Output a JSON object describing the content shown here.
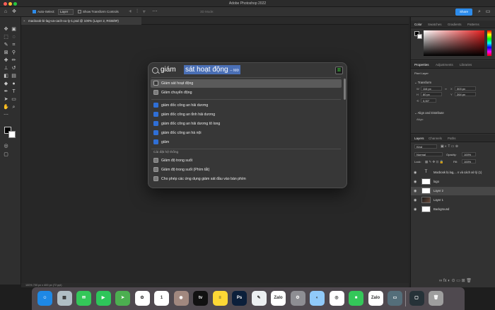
{
  "window": {
    "title": "Adobe Photoshop 2022"
  },
  "options_bar": {
    "auto_select_label": "Auto-Select:",
    "auto_select_value": "Layer",
    "show_transform_label": "Show Transform Controls",
    "mode_label": "3D Mode:",
    "share_label": "Share"
  },
  "document": {
    "tab_title": "macbook-bi-lag-va-cach-xu-ly-1.psd @ 100% (Layer 2, RGB/8#)",
    "status": "100%   700 px x 400 px (72 ppi)"
  },
  "spotlight": {
    "typed": "giám",
    "completion": "sát hoạt động",
    "completion_hint": "– Mở",
    "top_items": [
      {
        "label": "Giám sát hoạt động",
        "icon": "activity-monitor-icon",
        "selected": true
      },
      {
        "label": "Giảm chuyển động",
        "icon": "system-pref-icon",
        "selected": false
      }
    ],
    "doc_items": [
      {
        "label": "giám đốc công an hải dương",
        "icon": "document-icon"
      },
      {
        "label": "giám đốc công an tỉnh hải dương",
        "icon": "document-icon"
      },
      {
        "label": "giám đốc công an hải dương tô long",
        "icon": "document-icon"
      },
      {
        "label": "giám đốc công an hà nội",
        "icon": "document-icon"
      },
      {
        "label": "giảm",
        "icon": "document-icon"
      }
    ],
    "section_title": "Cài đặt hệ thống",
    "settings_items": [
      {
        "label": "Giảm độ trong suốt",
        "icon": "system-pref-icon"
      },
      {
        "label": "Giảm độ trong suốt (Phím tắt)",
        "icon": "system-pref-icon"
      },
      {
        "label": "Cho phép các ứng dụng giám sát đầu vào bàn phím",
        "icon": "system-pref-icon"
      }
    ]
  },
  "panels": {
    "color_tabs": [
      "Color",
      "Swatches",
      "Gradients",
      "Patterns"
    ],
    "properties_tabs": [
      "Properties",
      "Adjustments",
      "Libraries"
    ],
    "pixel_layer_label": "Pixel Layer",
    "transform_label": "Transform",
    "transform": {
      "w": "116 px",
      "h": "80 px",
      "x": "303 px",
      "y": "264 px",
      "angle": "0,00°"
    },
    "align_label": "Align and Distribute",
    "align_sub": "Align:",
    "layers_tabs": [
      "Layers",
      "Channels",
      "Paths"
    ],
    "kind_label": "Kind",
    "blend_mode": "Normal",
    "opacity_label": "Opacity:",
    "opacity_value": "100%",
    "lock_label": "Lock:",
    "fill_label": "Fill:",
    "fill_value": "100%",
    "layers": [
      {
        "name": "Macbook bị lag,... n và cách xử lý (1)",
        "thumb": "text",
        "selected": false
      },
      {
        "name": "logo",
        "thumb": "white",
        "selected": false
      },
      {
        "name": "Layer 2",
        "thumb": "white",
        "selected": true
      },
      {
        "name": "Layer 1",
        "thumb": "dark",
        "selected": false
      },
      {
        "name": "Background",
        "thumb": "white",
        "selected": false
      }
    ]
  },
  "dock": {
    "apps": [
      {
        "name": "Finder",
        "color": "#1e88e5",
        "glyph": "☺"
      },
      {
        "name": "Launchpad",
        "color": "#b0bec5",
        "glyph": "▦"
      },
      {
        "name": "Messages",
        "color": "#34c759",
        "glyph": "✉"
      },
      {
        "name": "FaceTime",
        "color": "#2ec55a",
        "glyph": "▶"
      },
      {
        "name": "Maps",
        "color": "#4caf50",
        "glyph": "➤"
      },
      {
        "name": "Photos",
        "color": "#ffffff",
        "glyph": "✿"
      },
      {
        "name": "Calendar",
        "color": "#ffffff",
        "glyph": "1"
      },
      {
        "name": "Contacts",
        "color": "#a1887f",
        "glyph": "◉"
      },
      {
        "name": "Apple TV",
        "color": "#111111",
        "glyph": "tv"
      },
      {
        "name": "Notes",
        "color": "#fdd835",
        "glyph": "≡"
      },
      {
        "name": "Photoshop",
        "color": "#0b1f3a",
        "glyph": "Ps"
      },
      {
        "name": "Pen",
        "color": "#eceff1",
        "glyph": "✎"
      },
      {
        "name": "Zalo",
        "color": "#ffffff",
        "glyph": "Zalo"
      },
      {
        "name": "Settings",
        "color": "#8e8e93",
        "glyph": "⚙"
      },
      {
        "name": "Preview",
        "color": "#90caf9",
        "glyph": "◐"
      },
      {
        "name": "Chrome",
        "color": "#ffffff",
        "glyph": "◎"
      },
      {
        "name": "FaceTime2",
        "color": "#34c759",
        "glyph": "■"
      },
      {
        "name": "Zalo2",
        "color": "#ffffff",
        "glyph": "Zalo"
      },
      {
        "name": "Screen",
        "color": "#546e7a",
        "glyph": "▭"
      },
      {
        "name": "Window",
        "color": "#263238",
        "glyph": "▢"
      },
      {
        "name": "Trash",
        "color": "#9e9e9e",
        "glyph": "🗑"
      }
    ],
    "badge_zalo": "11"
  }
}
